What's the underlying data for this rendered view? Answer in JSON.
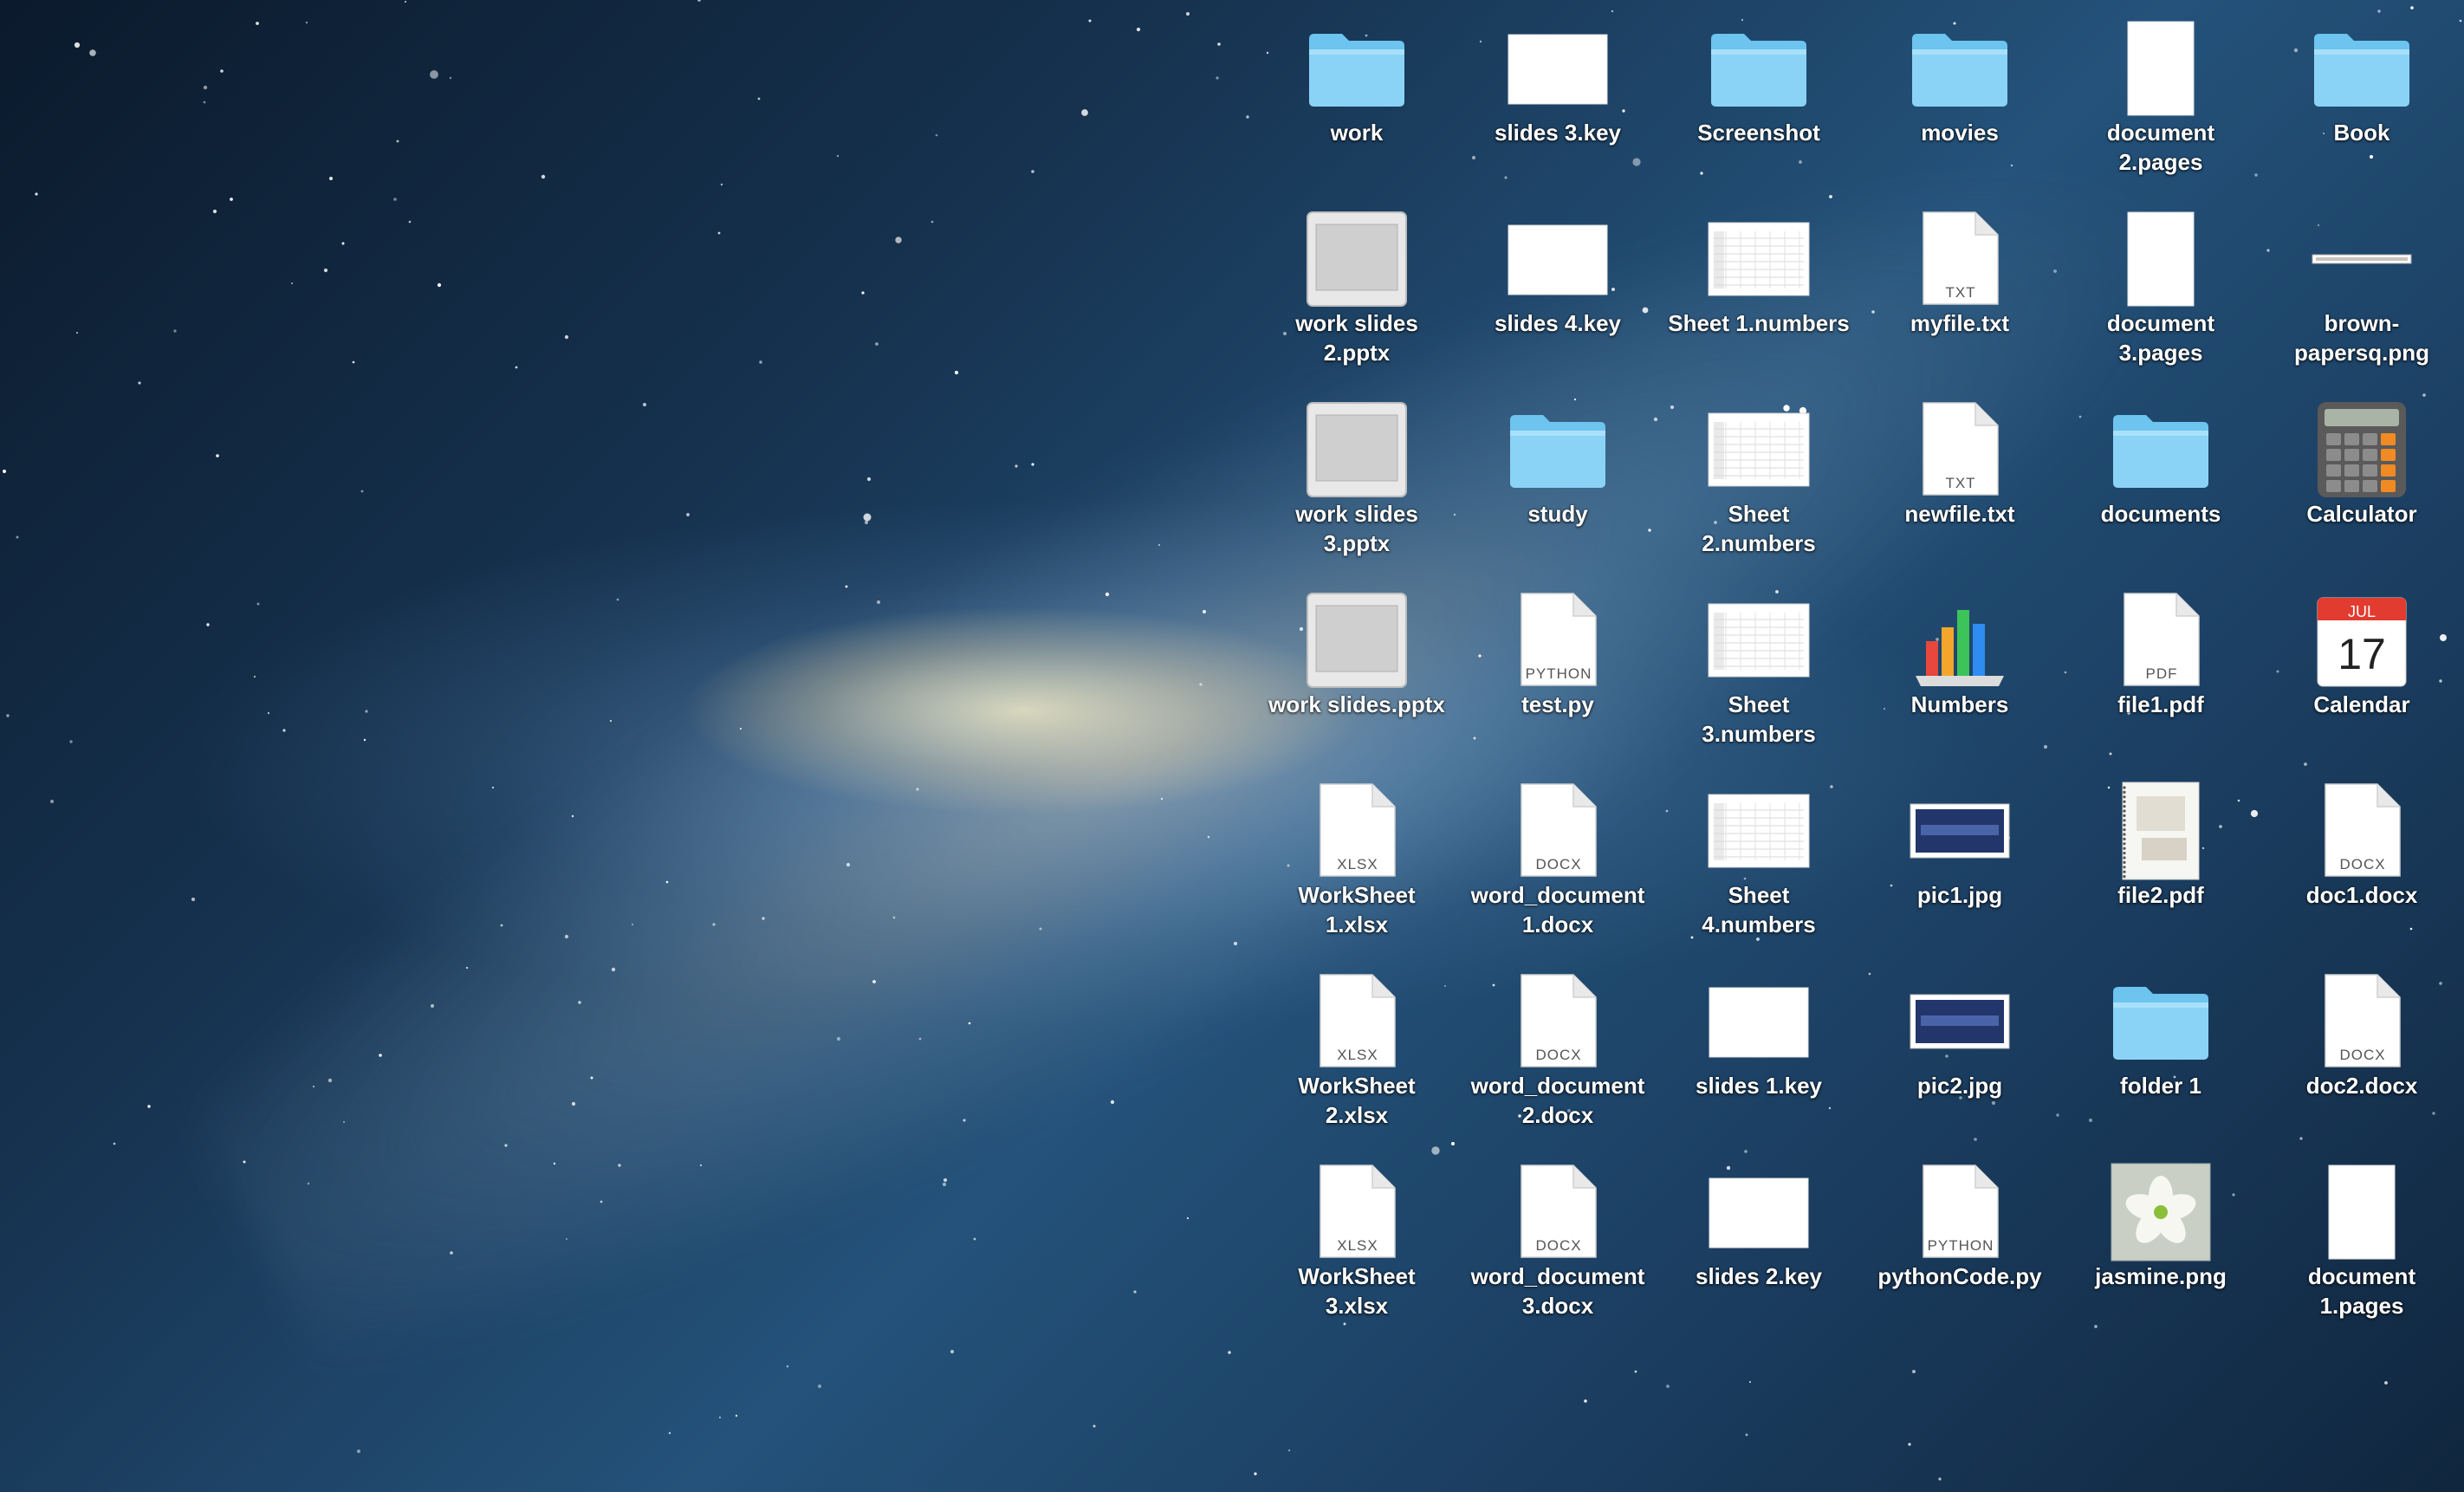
{
  "wallpaper": {
    "name": "galaxy"
  },
  "desktop_icons": [
    {
      "label": "work",
      "type": "folder-icon"
    },
    {
      "label": "slides 3.key",
      "type": "keynote-icon"
    },
    {
      "label": "Screenshot",
      "type": "folder-icon"
    },
    {
      "label": "movies",
      "type": "folder-icon"
    },
    {
      "label": "document\n2.pages",
      "type": "pages-icon"
    },
    {
      "label": "Book",
      "type": "folder-icon"
    },
    {
      "label": "work slides\n2.pptx",
      "type": "pptx-icon"
    },
    {
      "label": "slides 4.key",
      "type": "keynote-icon"
    },
    {
      "label": "Sheet 1.numbers",
      "type": "numbers-doc-icon"
    },
    {
      "label": "myfile.txt",
      "type": "txt-icon",
      "badge": "TXT"
    },
    {
      "label": "document\n3.pages",
      "type": "pages-icon"
    },
    {
      "label": "brown-\npapersq.png",
      "type": "png-strip-icon"
    },
    {
      "label": "work slides\n3.pptx",
      "type": "pptx-icon"
    },
    {
      "label": "study",
      "type": "folder-icon"
    },
    {
      "label": "Sheet\n2.numbers",
      "type": "numbers-doc-icon"
    },
    {
      "label": "newfile.txt",
      "type": "txt-icon",
      "badge": "TXT"
    },
    {
      "label": "documents",
      "type": "folder-icon"
    },
    {
      "label": "Calculator",
      "type": "calculator-icon"
    },
    {
      "label": "work slides.pptx",
      "type": "pptx-icon"
    },
    {
      "label": "test.py",
      "type": "python-icon",
      "badge": "PYTHON"
    },
    {
      "label": "Sheet\n3.numbers",
      "type": "numbers-doc-icon"
    },
    {
      "label": "Numbers",
      "type": "numbers-app-icon"
    },
    {
      "label": "file1.pdf",
      "type": "pdf-icon",
      "badge": "PDF"
    },
    {
      "label": "Calendar",
      "type": "calendar-icon",
      "month": "JUL",
      "day": "17"
    },
    {
      "label": "WorkSheet\n1.xlsx",
      "type": "xlsx-icon",
      "badge": "XLSX"
    },
    {
      "label": "word_document\n1.docx",
      "type": "docx-icon",
      "badge": "DOCX"
    },
    {
      "label": "Sheet\n4.numbers",
      "type": "numbers-doc-icon"
    },
    {
      "label": "pic1.jpg",
      "type": "image-thumb-icon"
    },
    {
      "label": "file2.pdf",
      "type": "pdf-thumb-icon"
    },
    {
      "label": "doc1.docx",
      "type": "docx-icon",
      "badge": "DOCX"
    },
    {
      "label": "WorkSheet\n2.xlsx",
      "type": "xlsx-icon",
      "badge": "XLSX"
    },
    {
      "label": "word_document\n2.docx",
      "type": "docx-icon",
      "badge": "DOCX"
    },
    {
      "label": "slides 1.key",
      "type": "keynote-icon"
    },
    {
      "label": "pic2.jpg",
      "type": "image-thumb-icon"
    },
    {
      "label": "folder 1",
      "type": "folder-icon"
    },
    {
      "label": "doc2.docx",
      "type": "docx-icon",
      "badge": "DOCX"
    },
    {
      "label": "WorkSheet\n3.xlsx",
      "type": "xlsx-icon",
      "badge": "XLSX"
    },
    {
      "label": "word_document\n3.docx",
      "type": "docx-icon",
      "badge": "DOCX"
    },
    {
      "label": "slides 2.key",
      "type": "keynote-icon"
    },
    {
      "label": "pythonCode.py",
      "type": "python-icon",
      "badge": "PYTHON"
    },
    {
      "label": "jasmine.png",
      "type": "flower-thumb-icon"
    },
    {
      "label": "document\n1.pages",
      "type": "pages-icon"
    }
  ]
}
